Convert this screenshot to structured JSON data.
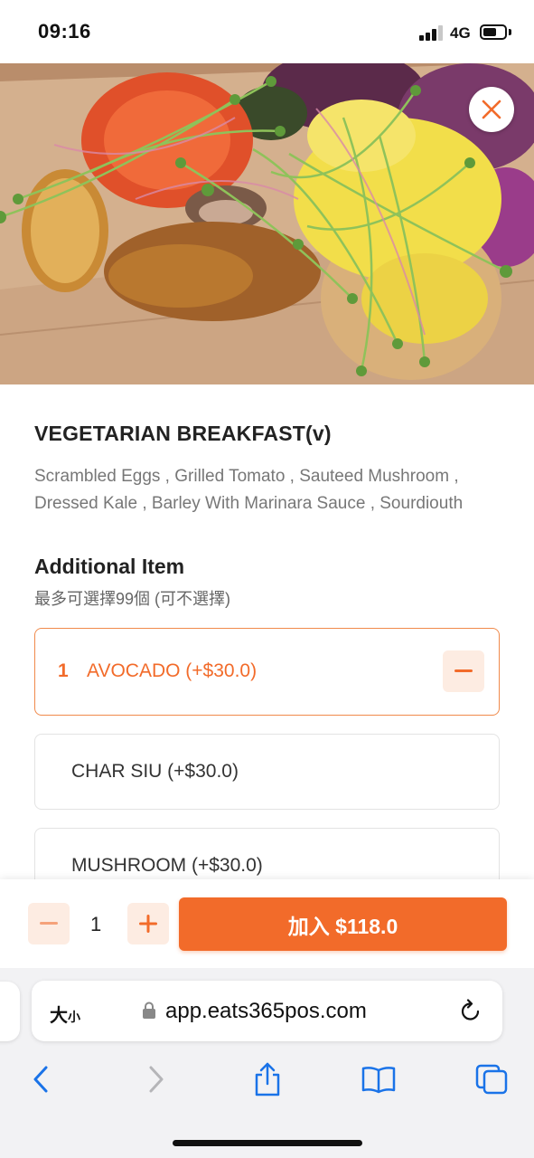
{
  "status_bar": {
    "time": "09:16",
    "network": "4G",
    "signal_bars": 3,
    "battery_level": 0.55
  },
  "dish": {
    "title": "VEGETARIAN BREAKFAST(v)",
    "description": "Scrambled Eggs , Grilled Tomato , Sauteed Mushroom , Dressed Kale , Barley With Marinara Sauce , Sourdiouth"
  },
  "additional": {
    "title": "Additional Item",
    "subtitle": "最多可選擇99個 (可不選擇)",
    "options": [
      {
        "qty": "1",
        "label": "AVOCADO (+$30.0)",
        "selected": true
      },
      {
        "label": "CHAR SIU (+$30.0)",
        "selected": false
      },
      {
        "label": "MUSHROOM (+$30.0)",
        "selected": false
      }
    ]
  },
  "cart": {
    "quantity": "1",
    "add_label": "加入 $118.0"
  },
  "browser": {
    "text_size_big": "大",
    "text_size_small": "小",
    "url": "app.eats365pos.com"
  },
  "colors": {
    "accent": "#f26b2a",
    "accent_soft": "#fdece2",
    "ios_blue": "#1a73e8"
  },
  "icons": {
    "close": "close-icon",
    "minus": "minus-icon",
    "plus": "plus-icon",
    "lock": "lock-icon",
    "reload": "reload-icon",
    "back": "back-chevron-icon",
    "forward": "forward-chevron-icon",
    "share": "share-icon",
    "bookmarks": "bookmarks-icon",
    "tabs": "tabs-icon"
  }
}
